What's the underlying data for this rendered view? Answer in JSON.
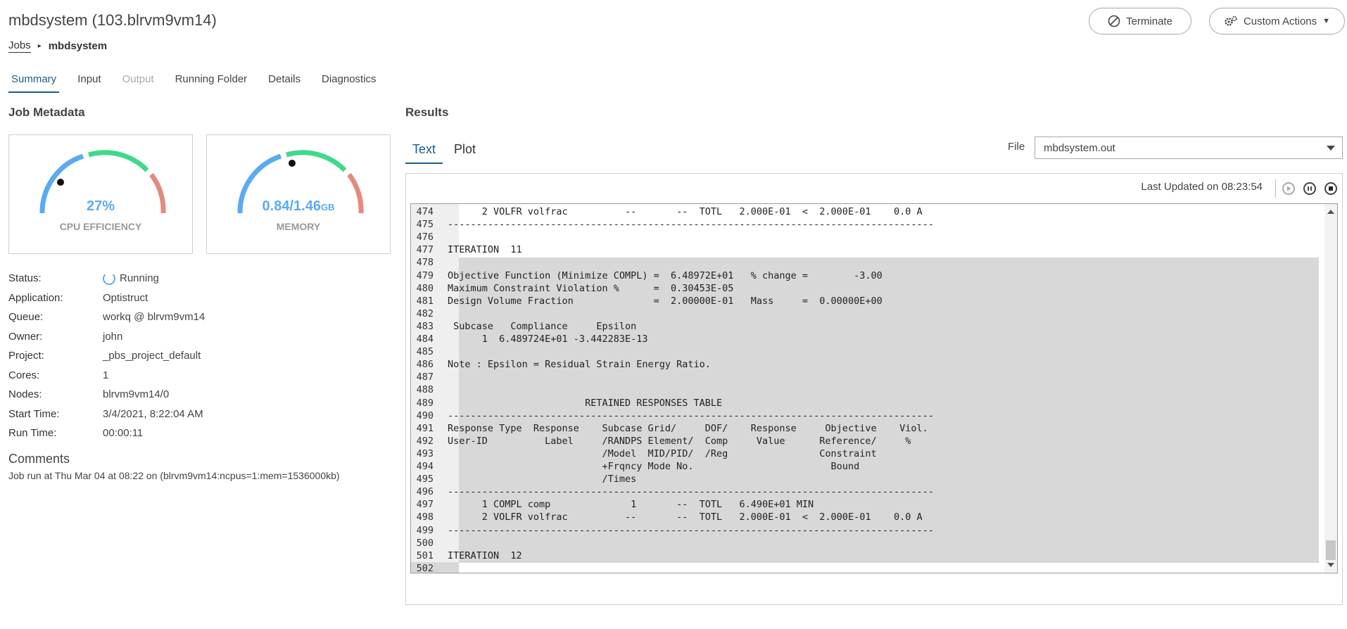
{
  "header": {
    "title": "mbdsystem (103.blrvm9vm14)"
  },
  "breadcrumb": {
    "root": "Jobs",
    "current": "mbdsystem"
  },
  "actions": {
    "terminate_label": "Terminate",
    "custom_actions_label": "Custom Actions"
  },
  "tabs": [
    {
      "label": "Summary",
      "state": "active"
    },
    {
      "label": "Input",
      "state": "normal"
    },
    {
      "label": "Output",
      "state": "disabled"
    },
    {
      "label": "Running Folder",
      "state": "normal"
    },
    {
      "label": "Details",
      "state": "normal"
    },
    {
      "label": "Diagnostics",
      "state": "normal"
    }
  ],
  "job_metadata": {
    "heading": "Job Metadata",
    "cpu": {
      "value_text": "27%",
      "label": "CPU EFFICIENCY",
      "percent": 27
    },
    "memory": {
      "value_text": "0.84/1.46",
      "unit": "GB",
      "label": "MEMORY",
      "used": 0.84,
      "total": 1.46
    },
    "fields": [
      {
        "key": "Status:",
        "value": "Running"
      },
      {
        "key": "Application:",
        "value": "Optistruct"
      },
      {
        "key": "Queue:",
        "value": "workq @ blrvm9vm14"
      },
      {
        "key": "Owner:",
        "value": "john"
      },
      {
        "key": "Project:",
        "value": "_pbs_project_default"
      },
      {
        "key": "Cores:",
        "value": "1"
      },
      {
        "key": "Nodes:",
        "value": "blrvm9vm14/0"
      },
      {
        "key": "Start Time:",
        "value": "3/4/2021, 8:22:04 AM"
      },
      {
        "key": "Run Time:",
        "value": "00:00:11"
      }
    ],
    "comments_heading": "Comments",
    "comments_text": "Job run at Thu Mar 04 at 08:22 on (blrvm9vm14:ncpus=1:mem=1536000kb)"
  },
  "results": {
    "heading": "Results",
    "tabs": [
      {
        "label": "Text",
        "state": "active"
      },
      {
        "label": "Plot",
        "state": "normal"
      }
    ],
    "file_label": "File",
    "file_value": "mbdsystem.out",
    "last_updated": "Last Updated on 08:23:54",
    "lines": [
      {
        "n": "474",
        "t": "      2 VOLFR volfrac          --       --  TOTL   2.000E-01  <  2.000E-01    0.0 A"
      },
      {
        "n": "475",
        "t": "-------------------------------------------------------------------------------------"
      },
      {
        "n": "476",
        "t": ""
      },
      {
        "n": "477",
        "t": "ITERATION  11"
      },
      {
        "n": "478",
        "t": ""
      },
      {
        "n": "479",
        "t": "Objective Function (Minimize COMPL) =  6.48972E+01   % change =        -3.00"
      },
      {
        "n": "480",
        "t": "Maximum Constraint Violation %      =  0.30453E-05"
      },
      {
        "n": "481",
        "t": "Design Volume Fraction              =  2.00000E-01   Mass     =  0.00000E+00"
      },
      {
        "n": "482",
        "t": ""
      },
      {
        "n": "483",
        "t": " Subcase   Compliance     Epsilon"
      },
      {
        "n": "484",
        "t": "      1  6.489724E+01 -3.442283E-13"
      },
      {
        "n": "485",
        "t": ""
      },
      {
        "n": "486",
        "t": "Note : Epsilon = Residual Strain Energy Ratio."
      },
      {
        "n": "487",
        "t": ""
      },
      {
        "n": "488",
        "t": ""
      },
      {
        "n": "489",
        "t": "                        RETAINED RESPONSES TABLE"
      },
      {
        "n": "490",
        "t": "-------------------------------------------------------------------------------------"
      },
      {
        "n": "491",
        "t": "Response Type  Response    Subcase Grid/     DOF/    Response     Objective    Viol."
      },
      {
        "n": "492",
        "t": "User-ID          Label     /RANDPS Element/  Comp     Value      Reference/     %"
      },
      {
        "n": "493",
        "t": "                           /Model  MID/PID/  /Reg                Constraint"
      },
      {
        "n": "494",
        "t": "                           +Frqncy Mode No.                        Bound"
      },
      {
        "n": "495",
        "t": "                           /Times"
      },
      {
        "n": "496",
        "t": "-------------------------------------------------------------------------------------"
      },
      {
        "n": "497",
        "t": "      1 COMPL comp              1       --  TOTL   6.490E+01 MIN"
      },
      {
        "n": "498",
        "t": "      2 VOLFR volfrac          --       --  TOTL   2.000E-01  <  2.000E-01    0.0 A"
      },
      {
        "n": "499",
        "t": "-------------------------------------------------------------------------------------"
      },
      {
        "n": "500",
        "t": ""
      },
      {
        "n": "501",
        "t": "ITERATION  12"
      },
      {
        "n": "502",
        "t": ""
      }
    ]
  },
  "colors": {
    "accent": "#1d5d8c",
    "gauge_blue": "#5aabf0",
    "gauge_green": "#3fd98a",
    "gauge_red": "#e48a80"
  },
  "icons": {
    "terminate": "ban-icon",
    "custom_actions": "cogs-icon"
  }
}
